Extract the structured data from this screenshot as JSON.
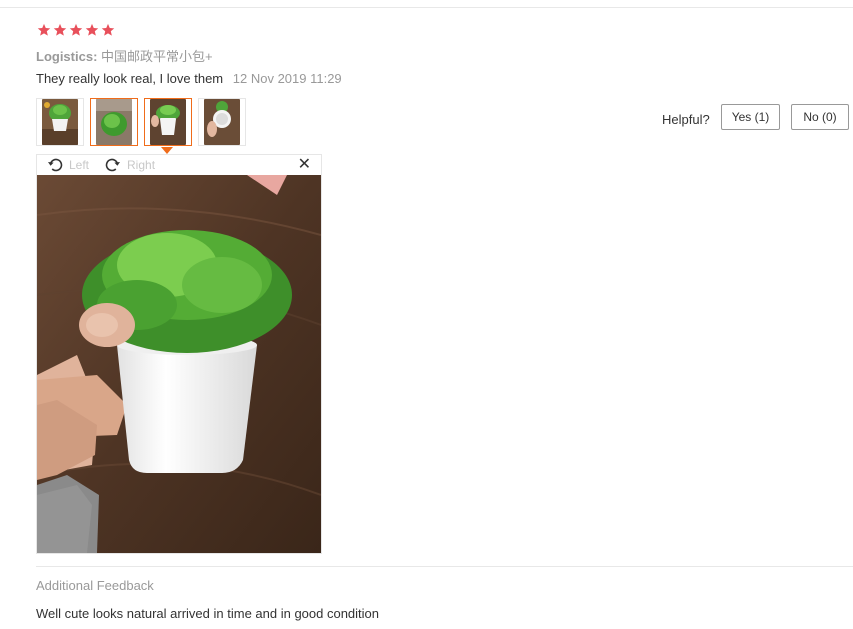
{
  "review": {
    "rating": 5,
    "stars_max": 5,
    "star_color": "#e8505b",
    "logistics_label": "Logistics:",
    "logistics_value": "中国邮政平常小包+",
    "text": "They really look real, I love them",
    "date": "12 Nov 2019 11:29",
    "thumbnails_count": 4,
    "selected_thumbnail": 3
  },
  "viewer": {
    "rotate_left_label": "Left",
    "rotate_right_label": "Right",
    "close_symbol": "✕"
  },
  "helpful": {
    "label": "Helpful?",
    "yes_label": "Yes (1)",
    "no_label": "No (0)"
  },
  "additional_feedback": {
    "heading": "Additional Feedback",
    "text": "Well cute looks natural arrived in time and in good condition"
  },
  "colors": {
    "accent": "#f06c1a",
    "muted_text": "#999999",
    "body_text": "#333333"
  }
}
